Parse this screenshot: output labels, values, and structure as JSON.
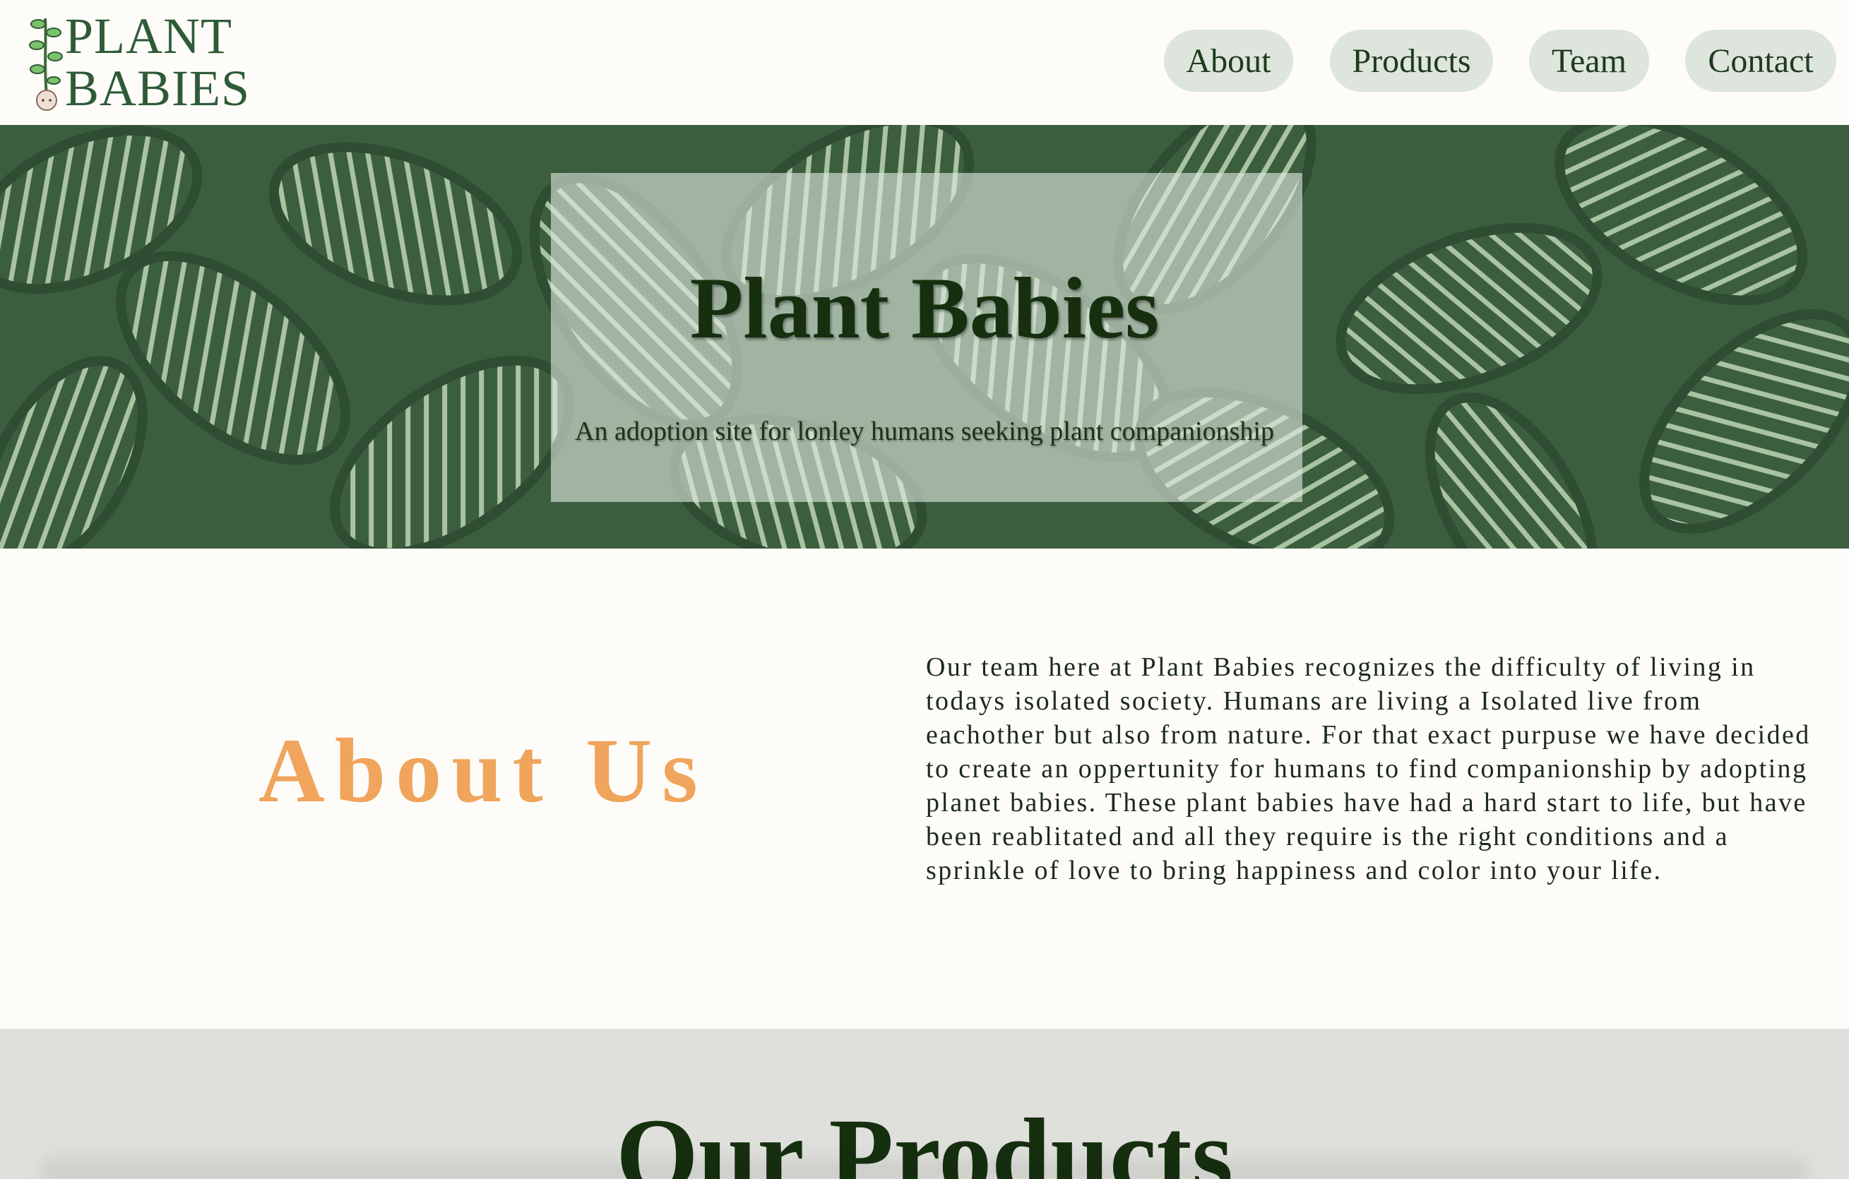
{
  "logo": {
    "line1": "PLANT",
    "line2": "BABIES"
  },
  "nav": {
    "items": [
      {
        "label": "About"
      },
      {
        "label": "Products"
      },
      {
        "label": "Team"
      },
      {
        "label": "Contact"
      }
    ]
  },
  "hero": {
    "title": "Plant Babies",
    "subtitle": "An adoption site for lonley humans seeking plant companionship"
  },
  "about": {
    "title": "About Us",
    "body": "Our team here at Plant Babies recognizes the difficulty of living in todays isolated society. Humans are living a Isolated live from eachother but also from nature. For that exact purpuse we have decided to create an oppertunity for humans to find companionship by adopting planet babies. These plant babies have had a hard start to life, but have been reablitated and all they require is the right conditions and a sprinkle of love to bring happiness and color into your life."
  },
  "products": {
    "title": "Our Products"
  },
  "colors": {
    "accent": "#f0a45c",
    "dark_green": "#16300f",
    "hero_green": "#3b5f3e",
    "nav_pill": "#dde5dc",
    "page_bg": "#fdfcf8"
  }
}
